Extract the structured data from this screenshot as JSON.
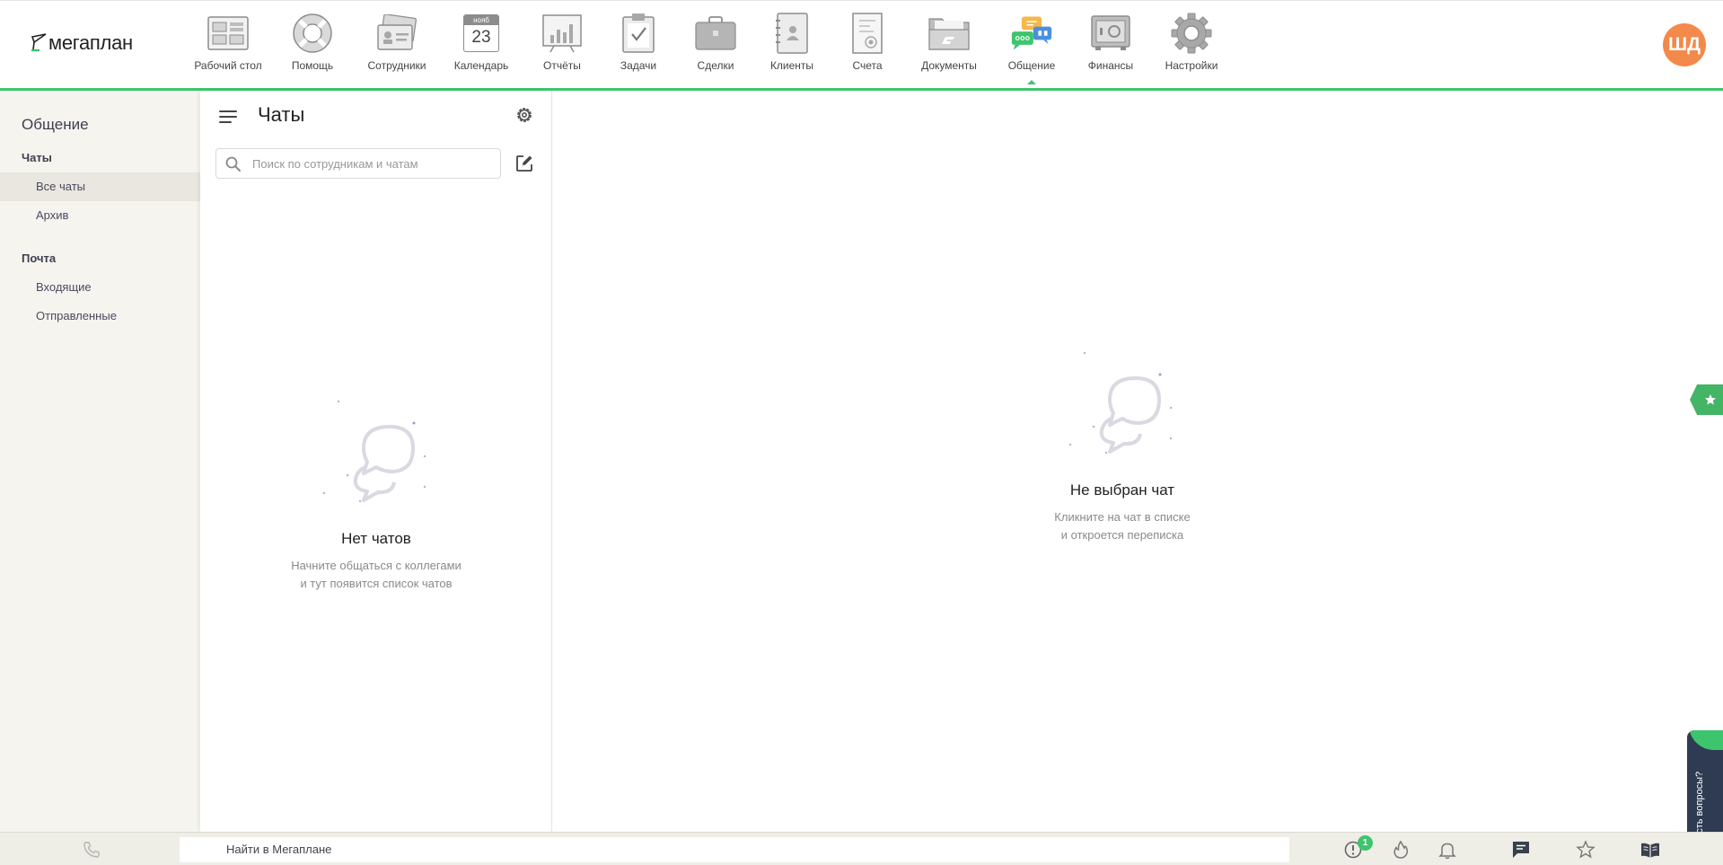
{
  "logo": {
    "text": "мегаплан"
  },
  "nav": [
    {
      "id": "desktop",
      "label": "Рабочий стол",
      "icon": "desktop-icon"
    },
    {
      "id": "help",
      "label": "Помощь",
      "icon": "lifebuoy-icon"
    },
    {
      "id": "staff",
      "label": "Сотрудники",
      "icon": "id-cards-icon"
    },
    {
      "id": "calendar",
      "label": "Календарь",
      "icon": "calendar-icon",
      "month": "нояб",
      "day": "23"
    },
    {
      "id": "reports",
      "label": "Отчёты",
      "icon": "chart-board-icon"
    },
    {
      "id": "tasks",
      "label": "Задачи",
      "icon": "clipboard-check-icon"
    },
    {
      "id": "deals",
      "label": "Сделки",
      "icon": "briefcase-icon"
    },
    {
      "id": "clients",
      "label": "Клиенты",
      "icon": "address-book-icon"
    },
    {
      "id": "invoices",
      "label": "Счета",
      "icon": "invoice-icon"
    },
    {
      "id": "documents",
      "label": "Документы",
      "icon": "folder-icon"
    },
    {
      "id": "communication",
      "label": "Общение",
      "icon": "chat-bubbles-icon",
      "active": true
    },
    {
      "id": "finance",
      "label": "Финансы",
      "icon": "safe-icon"
    },
    {
      "id": "settings",
      "label": "Настройки",
      "icon": "gear-icon"
    }
  ],
  "user": {
    "initials": "ШД",
    "avatar_color": "#f3894a"
  },
  "left_menu": {
    "title": "Общение",
    "sections": [
      {
        "title": "Чаты",
        "items": [
          {
            "label": "Все чаты",
            "active": true
          },
          {
            "label": "Архив"
          }
        ]
      },
      {
        "title": "Почта",
        "items": [
          {
            "label": "Входящие"
          },
          {
            "label": "Отправленные"
          }
        ]
      }
    ]
  },
  "chat_list": {
    "title": "Чаты",
    "search_placeholder": "Поиск по сотрудникам и чатам",
    "empty_title": "Нет чатов",
    "empty_line1": "Начните общаться с коллегами",
    "empty_line2": "и тут появится список чатов"
  },
  "chat_view": {
    "empty_title": "Не выбран чат",
    "empty_line1": "Кликните на чат в списке",
    "empty_line2": "и откроется переписка"
  },
  "help_tab": {
    "label": "Есть вопросы?"
  },
  "bottom_bar": {
    "search_label": "Найти в Мегаплане",
    "notification_count": "1"
  },
  "colors": {
    "accent": "#3ec46d",
    "menu_bg": "#f5f4ef",
    "bottom_bg": "#eeede6",
    "help_tab_bg": "#2f3b52"
  }
}
